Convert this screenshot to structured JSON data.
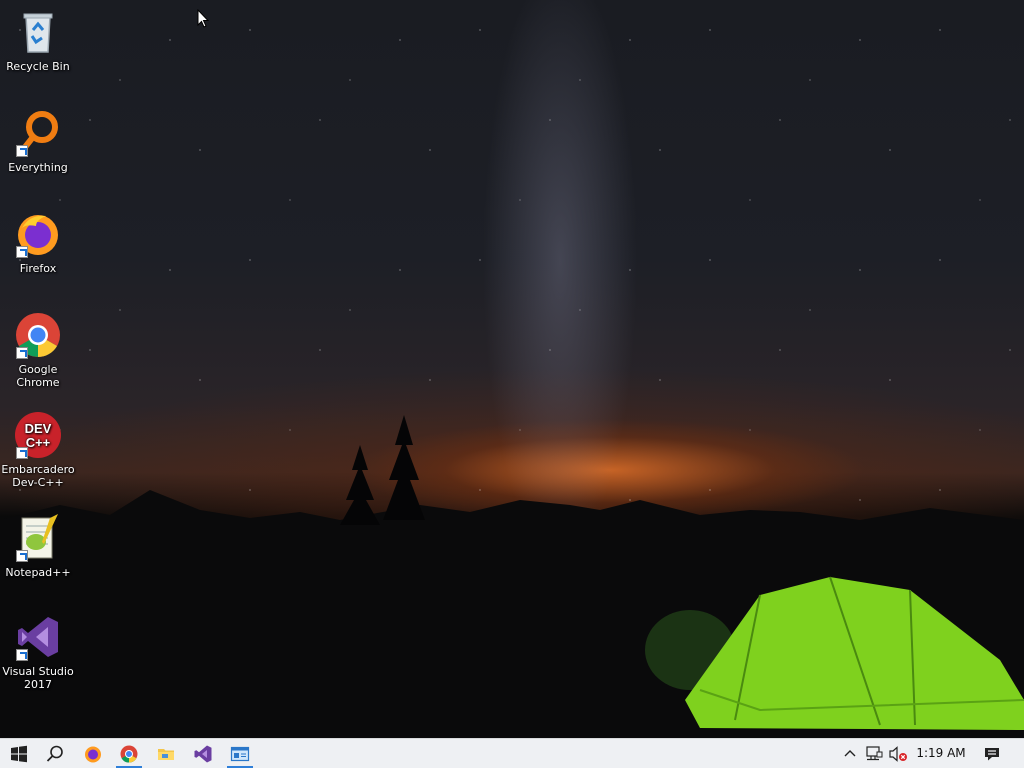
{
  "desktop": {
    "icons": [
      {
        "id": "recycle-bin",
        "label": "Recycle Bin",
        "shortcut": false
      },
      {
        "id": "everything",
        "label": "Everything",
        "shortcut": true
      },
      {
        "id": "firefox",
        "label": "Firefox",
        "shortcut": true
      },
      {
        "id": "google-chrome",
        "label": "Google Chrome",
        "shortcut": true
      },
      {
        "id": "dev-cpp",
        "label": "Embarcadero Dev-C++",
        "icon_text": "DEV C++",
        "shortcut": true
      },
      {
        "id": "notepad-plus-plus",
        "label": "Notepad++",
        "shortcut": true
      },
      {
        "id": "visual-studio",
        "label": "Visual Studio 2017",
        "shortcut": true
      }
    ]
  },
  "taskbar": {
    "buttons": [
      {
        "id": "start",
        "icon": "windows-logo-icon"
      },
      {
        "id": "search",
        "icon": "search-icon"
      },
      {
        "id": "firefox",
        "icon": "firefox-icon"
      },
      {
        "id": "chrome",
        "icon": "chrome-icon",
        "active": true
      },
      {
        "id": "file-explorer",
        "icon": "folder-icon"
      },
      {
        "id": "visual-studio",
        "icon": "visual-studio-icon"
      },
      {
        "id": "app-window",
        "icon": "window-app-icon",
        "active": true
      }
    ],
    "tray": {
      "chevron": "chevron-up-icon",
      "network": "network-icon",
      "volume": "volume-muted-icon",
      "time": "1:19 AM",
      "notifications": "action-center-icon"
    }
  },
  "colors": {
    "taskbar_bg": "#eef0f3",
    "active_indicator": "#2f7fd8",
    "vs_purple": "#6a3ea1",
    "firefox_orange": "#ff7a1a",
    "everything_orange": "#f07d12",
    "devcpp_red": "#c8222a"
  }
}
